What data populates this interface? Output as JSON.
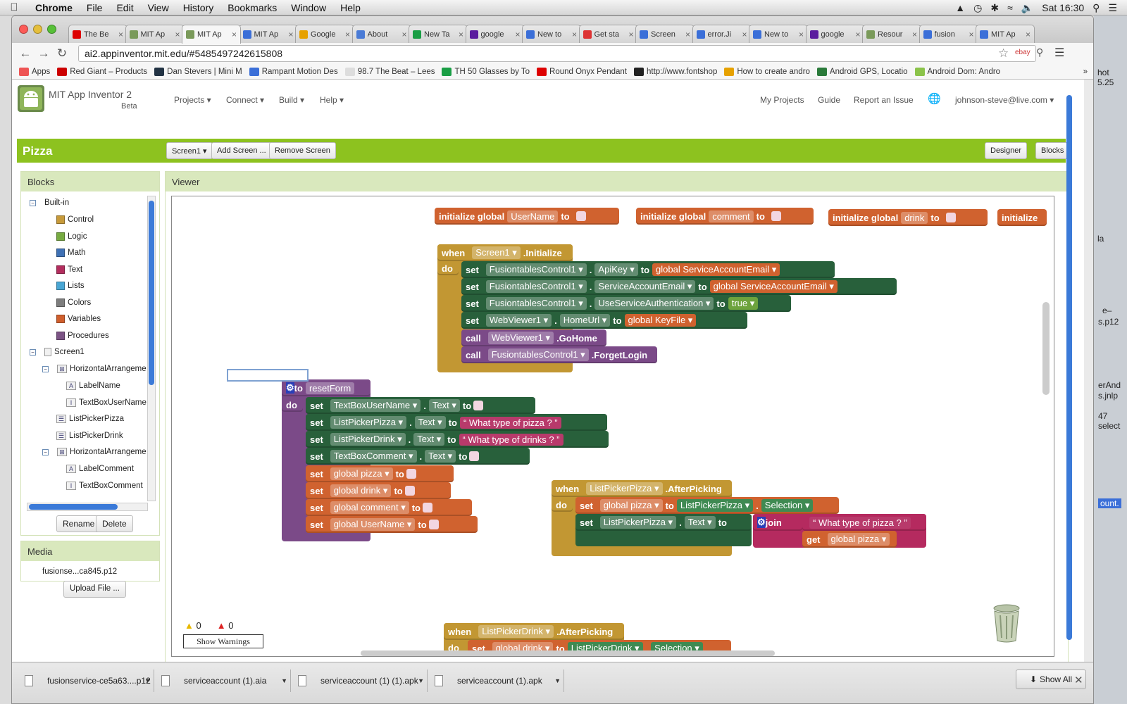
{
  "os": {
    "menubar": {
      "apple": "",
      "app": "Chrome",
      "items": [
        "File",
        "Edit",
        "View",
        "History",
        "Bookmarks",
        "Window",
        "Help"
      ],
      "clock": "Sat 16:30"
    }
  },
  "browser": {
    "tabs": [
      {
        "label": "The Be",
        "color": "#d00"
      },
      {
        "label": "MIT Ap",
        "color": "#7a9a5a"
      },
      {
        "label": "MIT Ap",
        "color": "#7a9a5a"
      },
      {
        "label": "MIT Ap",
        "color": "#3b6fd8"
      },
      {
        "label": "Google",
        "color": "#e6a100"
      },
      {
        "label": "About",
        "color": "#4a7bd6"
      },
      {
        "label": "New Ta",
        "color": "#1a9e45"
      },
      {
        "label": "google",
        "color": "#5a1c9e"
      },
      {
        "label": "New to",
        "color": "#3b6fd8"
      },
      {
        "label": "Get sta",
        "color": "#d33"
      },
      {
        "label": "Screen",
        "color": "#3b6fd8"
      },
      {
        "label": "error.Ji",
        "color": "#3b6fd8"
      },
      {
        "label": "New to",
        "color": "#3b6fd8"
      },
      {
        "label": "google",
        "color": "#5a1c9e"
      },
      {
        "label": "Resour",
        "color": "#7a9a5a"
      },
      {
        "label": "fusion",
        "color": "#3b6fd8"
      },
      {
        "label": "MIT Ap",
        "color": "#3b6fd8"
      }
    ],
    "active_tab": 2,
    "url": "ai2.appinventor.mit.edu/#5485497242615808",
    "bookmarks": [
      {
        "label": "Apps",
        "color": "#e55"
      },
      {
        "label": "Red Giant – Products",
        "color": "#c00"
      },
      {
        "label": "Dan Stevers | Mini M",
        "color": "#234"
      },
      {
        "label": "Rampant Motion Des",
        "color": "#3b6fd8"
      },
      {
        "label": "98.7 The Beat – Lees",
        "color": "#ddd"
      },
      {
        "label": "TH 50 Glasses by To",
        "color": "#1a9e45"
      },
      {
        "label": "Round Onyx Pendant",
        "color": "#d00"
      },
      {
        "label": "http://www.fontshop",
        "color": "#222"
      },
      {
        "label": "How to create andro",
        "color": "#e6a100"
      },
      {
        "label": "Android GPS, Locatio",
        "color": "#2a7a3a"
      },
      {
        "label": "Android Dom: Andro",
        "color": "#8bc34a"
      }
    ]
  },
  "appinventor": {
    "title": "MIT App Inventor 2",
    "beta": "Beta",
    "nav": [
      "Projects ▾",
      "Connect ▾",
      "Build ▾",
      "Help ▾"
    ],
    "right_nav": [
      "My Projects",
      "Guide",
      "Report an Issue"
    ],
    "user": "johnson-steve@live.com ▾",
    "project": "Pizza",
    "screen_select": "Screen1 ▾",
    "add_screen": "Add Screen ...",
    "remove_screen": "Remove Screen",
    "designer": "Designer",
    "blocks": "Blocks",
    "blocks_panel": {
      "title": "Blocks",
      "builtin": "Built-in",
      "builtins": [
        {
          "label": "Control",
          "color": "#c79a3a"
        },
        {
          "label": "Logic",
          "color": "#77ab41"
        },
        {
          "label": "Math",
          "color": "#3f71b5"
        },
        {
          "label": "Text",
          "color": "#b32d5e"
        },
        {
          "label": "Lists",
          "color": "#49a6d4"
        },
        {
          "label": "Colors",
          "color": "#7d7d7d"
        },
        {
          "label": "Variables",
          "color": "#d05f2d"
        },
        {
          "label": "Procedures",
          "color": "#7c5385"
        }
      ],
      "screen": "Screen1",
      "components": [
        "HorizontalArrangemen",
        "LabelName",
        "TextBoxUserName",
        "ListPickerPizza",
        "ListPickerDrink",
        "HorizontalArrangemen",
        "LabelComment",
        "TextBoxComment"
      ],
      "rename": "Rename",
      "delete": "Delete"
    },
    "media": {
      "title": "Media",
      "file": "fusionse...ca845.p12",
      "upload": "Upload File ..."
    },
    "viewer": {
      "title": "Viewer",
      "globals": [
        "UserName",
        "comment",
        "drink"
      ],
      "initialize": "initialize global",
      "init_partial": "initialize",
      "to": "to",
      "when": "when",
      "do": "do",
      "set": "set",
      "get": "get",
      "call": "call",
      "init_block": {
        "component": "Screen1",
        "event": ".Initialize",
        "rows": [
          {
            "comp": "FusiontablesControl1",
            "prop": "ApiKey",
            "value": "global ServiceAccountEmail"
          },
          {
            "comp": "FusiontablesControl1",
            "prop": "ServiceAccountEmail",
            "value": "global ServiceAccountEmail"
          },
          {
            "comp": "FusiontablesControl1",
            "prop": "UseServiceAuthentication",
            "value": "true"
          },
          {
            "comp": "WebViewer1",
            "prop": "HomeUrl",
            "value": "global KeyFile"
          }
        ],
        "calls": [
          {
            "comp": "WebViewer1",
            "method": ".GoHome"
          },
          {
            "comp": "FusiontablesControl1",
            "method": ".ForgetLogin"
          }
        ]
      },
      "reset_proc": {
        "name": "resetForm",
        "sets": [
          {
            "comp": "TextBoxUserName",
            "prop": "Text",
            "value": ""
          },
          {
            "comp": "ListPickerPizza",
            "prop": "Text",
            "value": "What type of pizza ?"
          },
          {
            "comp": "ListPickerDrink",
            "prop": "Text",
            "value": "What type of drinks ?"
          },
          {
            "comp": "TextBoxComment",
            "prop": "Text",
            "value": ""
          }
        ],
        "globals": [
          "global pizza",
          "global drink",
          "global comment",
          "global UserName"
        ]
      },
      "pizza_event": {
        "component": "ListPickerPizza",
        "event": ".AfterPicking",
        "set1_var": "global pizza",
        "set1_comp": "ListPickerPizza",
        "set1_prop": "Selection",
        "set2_comp": "ListPickerPizza",
        "set2_prop": "Text",
        "join": "join",
        "join_text": "What type of pizza ?",
        "join_get": "global pizza"
      },
      "drink_event": {
        "component": "ListPickerDrink",
        "event": ".AfterPicking",
        "set_var": "global drink",
        "comp": "ListPickerDrink",
        "prop": "Selection"
      },
      "warnings": "0",
      "errors": "0",
      "show_warnings": "Show Warnings"
    }
  },
  "downloads": {
    "items": [
      "fusionservice-ce5a63....p12",
      "serviceaccount (1).aia",
      "serviceaccount (1) (1).apk",
      "serviceaccount (1).apk"
    ],
    "show_all": "Show All"
  },
  "desktop_edge": [
    "hot",
    "5.25",
    "la",
    "e–",
    "s.p12",
    "erAnd",
    "s.jnlp",
    "47 select",
    "ount."
  ]
}
